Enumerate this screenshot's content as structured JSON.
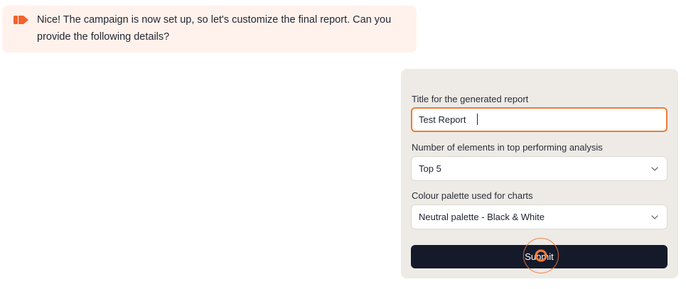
{
  "message": {
    "icon": "brand-arrow-icon",
    "text": "Nice! The campaign is now set up, so let's customize the final report. Can you provide the following details?"
  },
  "form": {
    "title_field": {
      "label": "Title for the generated report",
      "value": "Test Report"
    },
    "top_elements_field": {
      "label": "Number of elements in top performing analysis",
      "selected": "Top 5"
    },
    "palette_field": {
      "label": "Colour palette used for charts",
      "selected": "Neutral palette - Black & White"
    },
    "submit_label": "Submit"
  },
  "colors": {
    "accent": "#ee7a3a",
    "brand_icon": "#f2622e",
    "message_bg": "#fff2ec",
    "card_bg": "#eeebe6",
    "button_bg": "#151a2a"
  }
}
